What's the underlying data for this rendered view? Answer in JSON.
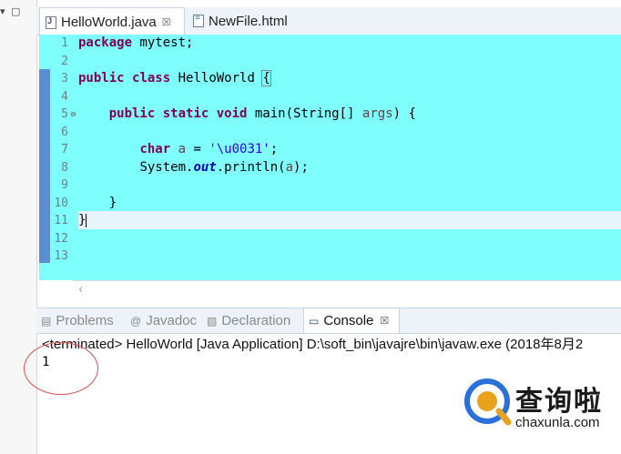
{
  "editor_tabs": [
    {
      "label": "HelloWorld.java",
      "close": "☒",
      "icon": "java-file-icon",
      "active": true
    },
    {
      "label": "NewFile.html",
      "icon": "html-file-icon",
      "active": false
    }
  ],
  "left_strip": {
    "icons": [
      "minimize-icon",
      "maximize-icon"
    ]
  },
  "editor": {
    "line_numbers": [
      "1",
      "2",
      "3",
      "4",
      "5",
      "6",
      "7",
      "8",
      "9",
      "10",
      "11",
      "12",
      "13"
    ],
    "lines": {
      "l1_kw": "package",
      "l1_rest": " mytest;",
      "l3_kw1": "public",
      "l3_kw2": "class",
      "l3_rest": " HelloWorld ",
      "l3_brace": "{",
      "l5_kw1": "public",
      "l5_kw2": "static",
      "l5_kw3": "void",
      "l5_rest": " main(String[] ",
      "l5_arg": "args",
      "l5_end": ") {",
      "l7_kw": "char",
      "l7_var": " a",
      "l7_eq": " = ",
      "l7_str": "'\\u0031'",
      "l7_end": ";",
      "l8_pre": "System.",
      "l8_field": "out",
      "l8_mid": ".println(",
      "l8_var": "a",
      "l8_end": ");",
      "l10": "}",
      "l11": "}"
    }
  },
  "view_tabs": [
    {
      "label": "Problems",
      "icon": "problems-icon",
      "active": false
    },
    {
      "label": "Javadoc",
      "icon": "at-icon",
      "active": false
    },
    {
      "label": "Declaration",
      "icon": "declaration-icon",
      "active": false
    },
    {
      "label": "Console",
      "icon": "console-icon",
      "active": true,
      "close": "☒"
    }
  ],
  "console": {
    "status": "<terminated> HelloWorld [Java Application] D:\\soft_bin\\javajre\\bin\\javaw.exe (2018年8月2",
    "output": "1"
  },
  "watermark": {
    "title": "查询啦",
    "domain": "chaxunla.com"
  },
  "colors": {
    "editor_bg": "#7ffefe",
    "annotation_circle": "#e0504a",
    "keyword": "#7f0055",
    "string": "#2a00ff"
  }
}
